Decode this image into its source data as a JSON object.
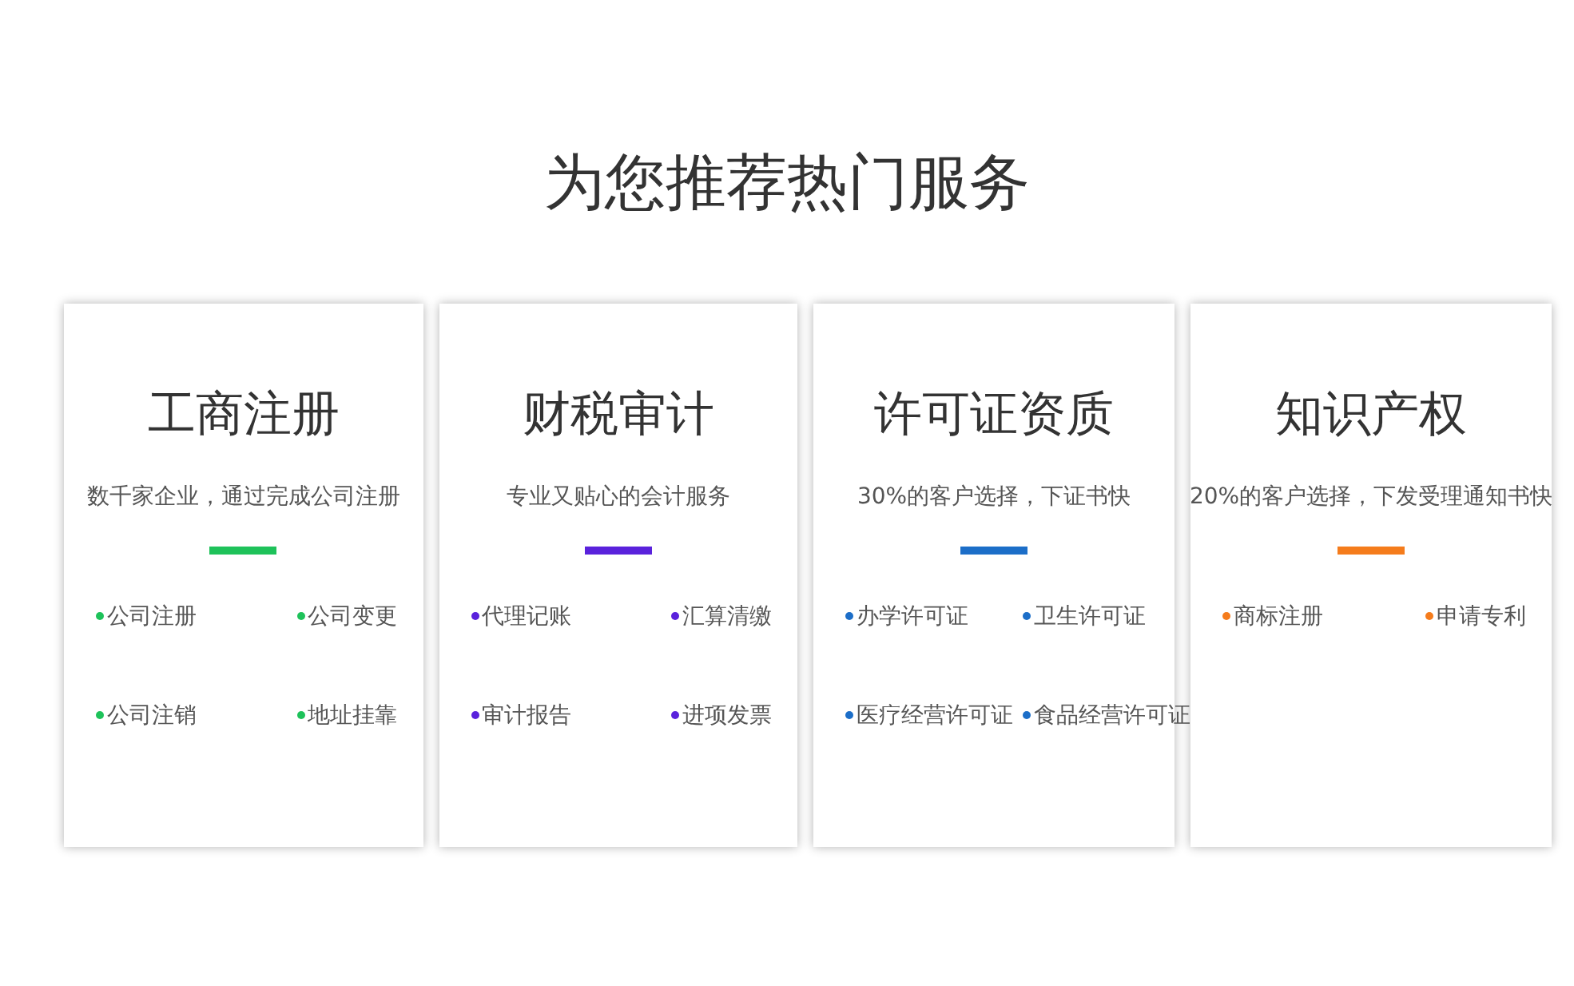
{
  "heading": "为您推荐热门服务",
  "cards": [
    {
      "title": "工商注册",
      "subtitle": "数千家企业，通过完成公司注册",
      "color": "#1ec25a",
      "items": [
        "公司注册",
        "公司变更",
        "公司注销",
        "地址挂靠"
      ]
    },
    {
      "title": "财税审计",
      "subtitle": "专业又贴心的会计服务",
      "color": "#5a22dc",
      "items": [
        "代理记账",
        "汇算清缴",
        "审计报告",
        "进项发票"
      ]
    },
    {
      "title": "许可证资质",
      "subtitle": "30%的客户选择，下证书快",
      "color": "#1c6ec8",
      "items": [
        "办学许可证",
        "卫生许可证",
        "医疗经营许可证",
        "食品经营许可证"
      ]
    },
    {
      "title": "知识产权",
      "subtitle": "20%的客户选择，下发受理通知书快",
      "color": "#f57c1c",
      "items": [
        "商标注册",
        "申请专利"
      ]
    }
  ]
}
